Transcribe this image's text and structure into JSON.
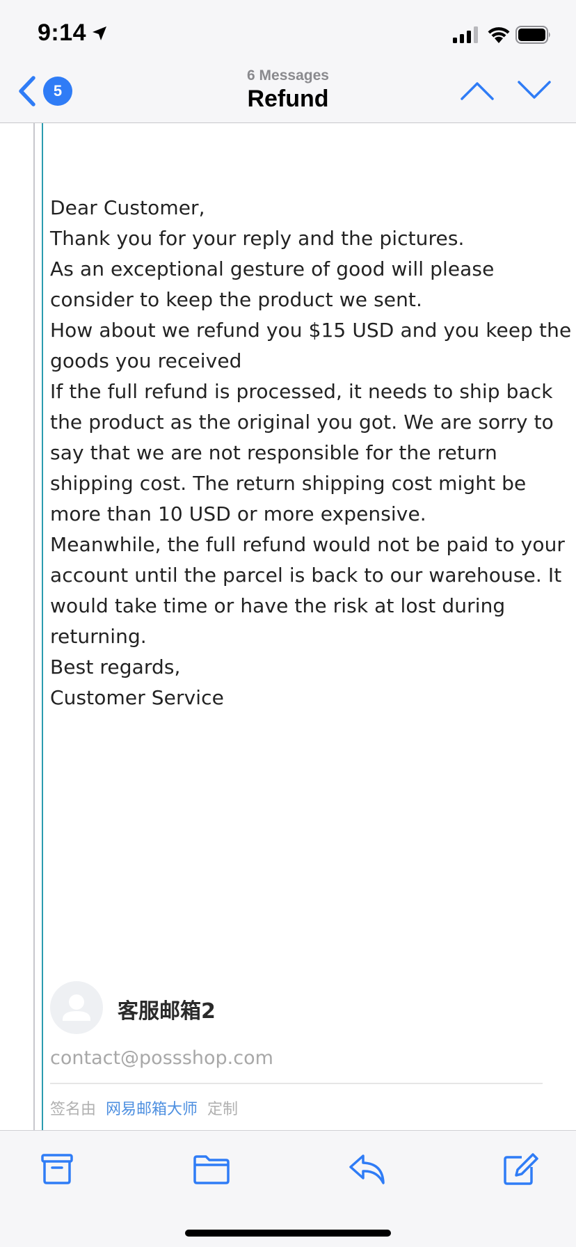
{
  "status_bar": {
    "time": "9:14"
  },
  "nav": {
    "back_count": "5",
    "subtitle": "6 Messages",
    "title": "Refund",
    "icons": [
      "chevron-left-icon",
      "chevron-up-icon",
      "chevron-down-icon"
    ]
  },
  "message": {
    "lines": [
      "Dear Customer,",
      "Thank you for your reply and the pictures.",
      "As an exceptional gesture of good will please",
      "consider to keep the product we sent.",
      "How about we refund you $15 USD and you keep the",
      "goods you received",
      "If the full refund is processed, it needs to ship back",
      "the product as the original you got. We are sorry to",
      "say that we are not responsible for the return",
      "shipping cost. The return shipping cost might be",
      "more than 10 USD or more expensive.",
      "Meanwhile, the full refund would not be paid to your",
      "account until the parcel is back to our warehouse. It",
      "would take time or have the risk at lost during",
      "returning.",
      "Best regards,",
      "Customer Service"
    ]
  },
  "signature": {
    "name": "客服邮箱2",
    "email": "contact@possshop.com",
    "footer_prefix": "签名由",
    "footer_link": "网易邮箱大师",
    "footer_suffix": "定制"
  },
  "toolbar": {
    "icons": [
      "archive-icon",
      "folder-icon",
      "reply-icon",
      "compose-icon"
    ]
  },
  "colors": {
    "accent": "#2f7cf6",
    "quote_bar": "#2b9cb0",
    "bar_background": "#f6f6f8"
  }
}
